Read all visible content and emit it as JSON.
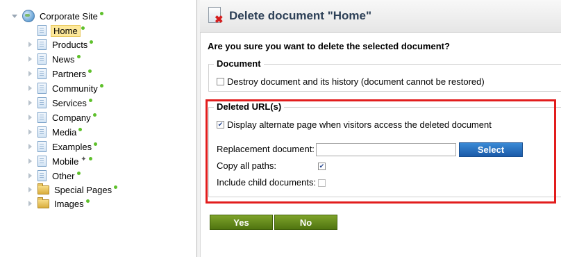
{
  "tree": {
    "root": {
      "label": "Corporate Site",
      "icon": "globe-icon"
    },
    "items": [
      {
        "label": "Home",
        "icon": "document-icon",
        "selected": true
      },
      {
        "label": "Products",
        "icon": "document-icon"
      },
      {
        "label": "News",
        "icon": "document-icon"
      },
      {
        "label": "Partners",
        "icon": "document-icon"
      },
      {
        "label": "Community",
        "icon": "document-icon"
      },
      {
        "label": "Services",
        "icon": "document-icon"
      },
      {
        "label": "Company",
        "icon": "document-icon"
      },
      {
        "label": "Media",
        "icon": "document-icon"
      },
      {
        "label": "Examples",
        "icon": "document-icon"
      },
      {
        "label": "Mobile",
        "icon": "document-icon"
      },
      {
        "label": "Other",
        "icon": "document-icon"
      },
      {
        "label": "Special Pages",
        "icon": "folder-icon"
      },
      {
        "label": "Images",
        "icon": "folder-icon"
      }
    ],
    "status_color": "#5ec02b"
  },
  "dialog": {
    "title": "Delete document \"Home\"",
    "question": "Are you sure you want to delete the selected document?",
    "document_section": {
      "legend": "Document",
      "destroy_label": "Destroy document and its history (document cannot be restored)",
      "destroy_checked": false
    },
    "deleted_urls": {
      "legend": "Deleted URL(s)",
      "alternate_label": "Display alternate page when visitors access the deleted document",
      "alternate_checked": true,
      "replacement_label": "Replacement document:",
      "replacement_value": "",
      "select_button": "Select",
      "copy_paths_label": "Copy all paths:",
      "copy_paths_checked": true,
      "include_children_label": "Include child documents:",
      "include_children_checked": false
    },
    "yes_button": "Yes",
    "no_button": "No"
  },
  "colors": {
    "highlight_border": "#e21d1d",
    "select_button": "#2a72c0",
    "action_button": "#668c1d",
    "title_text": "#2d4057"
  }
}
